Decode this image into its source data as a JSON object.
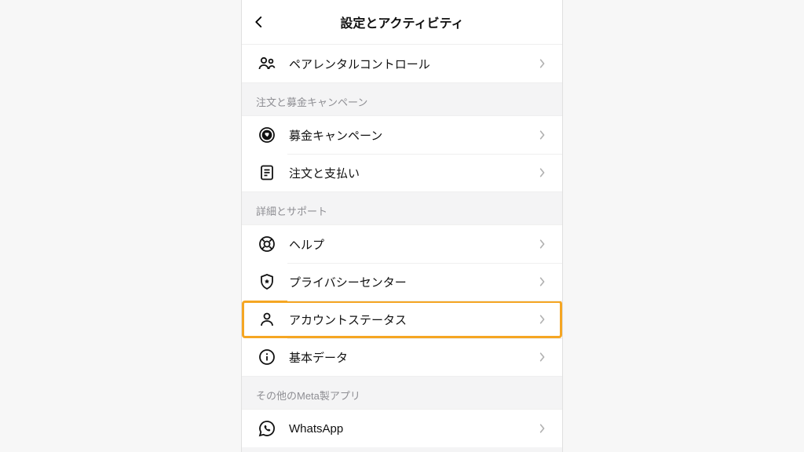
{
  "header": {
    "title": "設定とアクティビティ"
  },
  "rows": {
    "parental": {
      "label": "ペアレンタルコントロール"
    },
    "section_orders": "注文と募金キャンペーン",
    "fundraiser": {
      "label": "募金キャンペーン"
    },
    "orders": {
      "label": "注文と支払い"
    },
    "section_support": "詳細とサポート",
    "help": {
      "label": "ヘルプ"
    },
    "privacy": {
      "label": "プライバシーセンター"
    },
    "account_status": {
      "label": "アカウントステータス"
    },
    "about": {
      "label": "基本データ"
    },
    "section_meta": "その他のMeta製アプリ",
    "whatsapp": {
      "label": "WhatsApp"
    }
  }
}
